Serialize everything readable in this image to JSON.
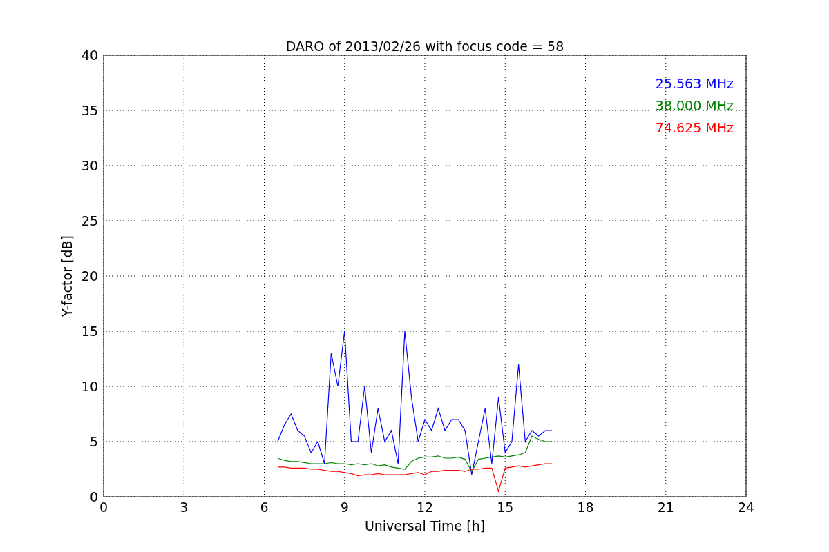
{
  "chart_data": {
    "type": "line",
    "title": "DARO of 2013/02/26 with focus code = 58",
    "xlabel": "Universal Time [h]",
    "ylabel": "Y-factor [dB]",
    "x": [
      6.5,
      6.75,
      7,
      7.25,
      7.5,
      7.75,
      8,
      8.25,
      8.5,
      8.75,
      9,
      9.25,
      9.5,
      9.75,
      10,
      10.25,
      10.5,
      10.75,
      11,
      11.25,
      11.5,
      11.75,
      12,
      12.25,
      12.5,
      12.75,
      13,
      13.25,
      13.5,
      13.75,
      14,
      14.25,
      14.5,
      14.75,
      15,
      15.25,
      15.5,
      15.75,
      16,
      16.25,
      16.5,
      16.75
    ],
    "series": [
      {
        "name": "25.563 MHz",
        "color": "#0000ff",
        "values": [
          5,
          6.5,
          7.5,
          6,
          5.5,
          4,
          5,
          3,
          13,
          10,
          15,
          5,
          5,
          10,
          4,
          8,
          5,
          6,
          3,
          15,
          9,
          5,
          7,
          6,
          8,
          6,
          7,
          7,
          6,
          2,
          5,
          8,
          3,
          9,
          4,
          5,
          12,
          5,
          6,
          5.5,
          6,
          6
        ]
      },
      {
        "name": "38.000 MHz",
        "color": "#008000",
        "values": [
          3.5,
          3.3,
          3.2,
          3.2,
          3.1,
          3,
          3,
          3,
          3.1,
          3,
          3,
          2.9,
          3,
          2.9,
          3,
          2.8,
          2.9,
          2.7,
          2.6,
          2.5,
          3.2,
          3.5,
          3.6,
          3.6,
          3.7,
          3.5,
          3.5,
          3.6,
          3.4,
          2.3,
          3.4,
          3.5,
          3.6,
          3.7,
          3.6,
          3.7,
          3.8,
          4,
          5.5,
          5.2,
          5,
          5
        ]
      },
      {
        "name": "74.625 MHz",
        "color": "#ff0000",
        "values": [
          2.7,
          2.7,
          2.6,
          2.6,
          2.6,
          2.5,
          2.5,
          2.4,
          2.3,
          2.3,
          2.2,
          2.1,
          1.9,
          2,
          2,
          2.1,
          2,
          2,
          2,
          2,
          2.1,
          2.2,
          2,
          2.3,
          2.3,
          2.4,
          2.4,
          2.4,
          2.3,
          2.5,
          2.5,
          2.6,
          2.6,
          0.5,
          2.6,
          2.7,
          2.8,
          2.7,
          2.8,
          2.9,
          3,
          3
        ]
      }
    ],
    "grid": true,
    "xlim": [
      0,
      24
    ],
    "ylim": [
      0,
      40
    ],
    "xticks": [
      0,
      3,
      6,
      9,
      12,
      15,
      18,
      21,
      24
    ],
    "yticks": [
      0,
      5,
      10,
      15,
      20,
      25,
      30,
      35,
      40
    ]
  }
}
